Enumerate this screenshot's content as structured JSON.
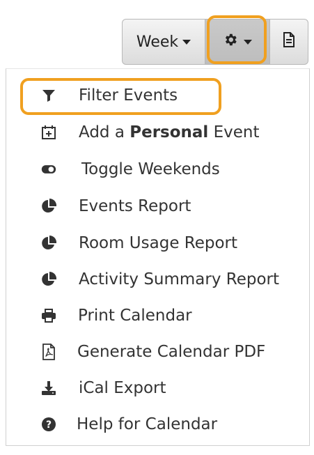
{
  "toolbar": {
    "view_label": "Week",
    "gear_icon": "gear-icon",
    "doc_icon": "document-icon"
  },
  "menu": {
    "items": [
      {
        "icon": "filter-icon",
        "label": "Filter Events"
      },
      {
        "icon": "calendar-plus-icon",
        "label_pre": "Add a ",
        "label_bold": "Personal",
        "label_post": " Event"
      },
      {
        "icon": "toggle-icon",
        "label": "Toggle Weekends"
      },
      {
        "icon": "pie-chart-icon",
        "label": "Events Report"
      },
      {
        "icon": "pie-chart-icon",
        "label": "Room Usage Report"
      },
      {
        "icon": "pie-chart-icon",
        "label": "Activity Summary Report"
      },
      {
        "icon": "printer-icon",
        "label": "Print Calendar"
      },
      {
        "icon": "pdf-file-icon",
        "label": "Generate Calendar PDF"
      },
      {
        "icon": "download-icon",
        "label": "iCal Export"
      },
      {
        "icon": "help-icon",
        "label": "Help for Calendar"
      }
    ]
  },
  "colors": {
    "highlight": "#f0a020",
    "text": "#333333",
    "icon": "#333333"
  }
}
